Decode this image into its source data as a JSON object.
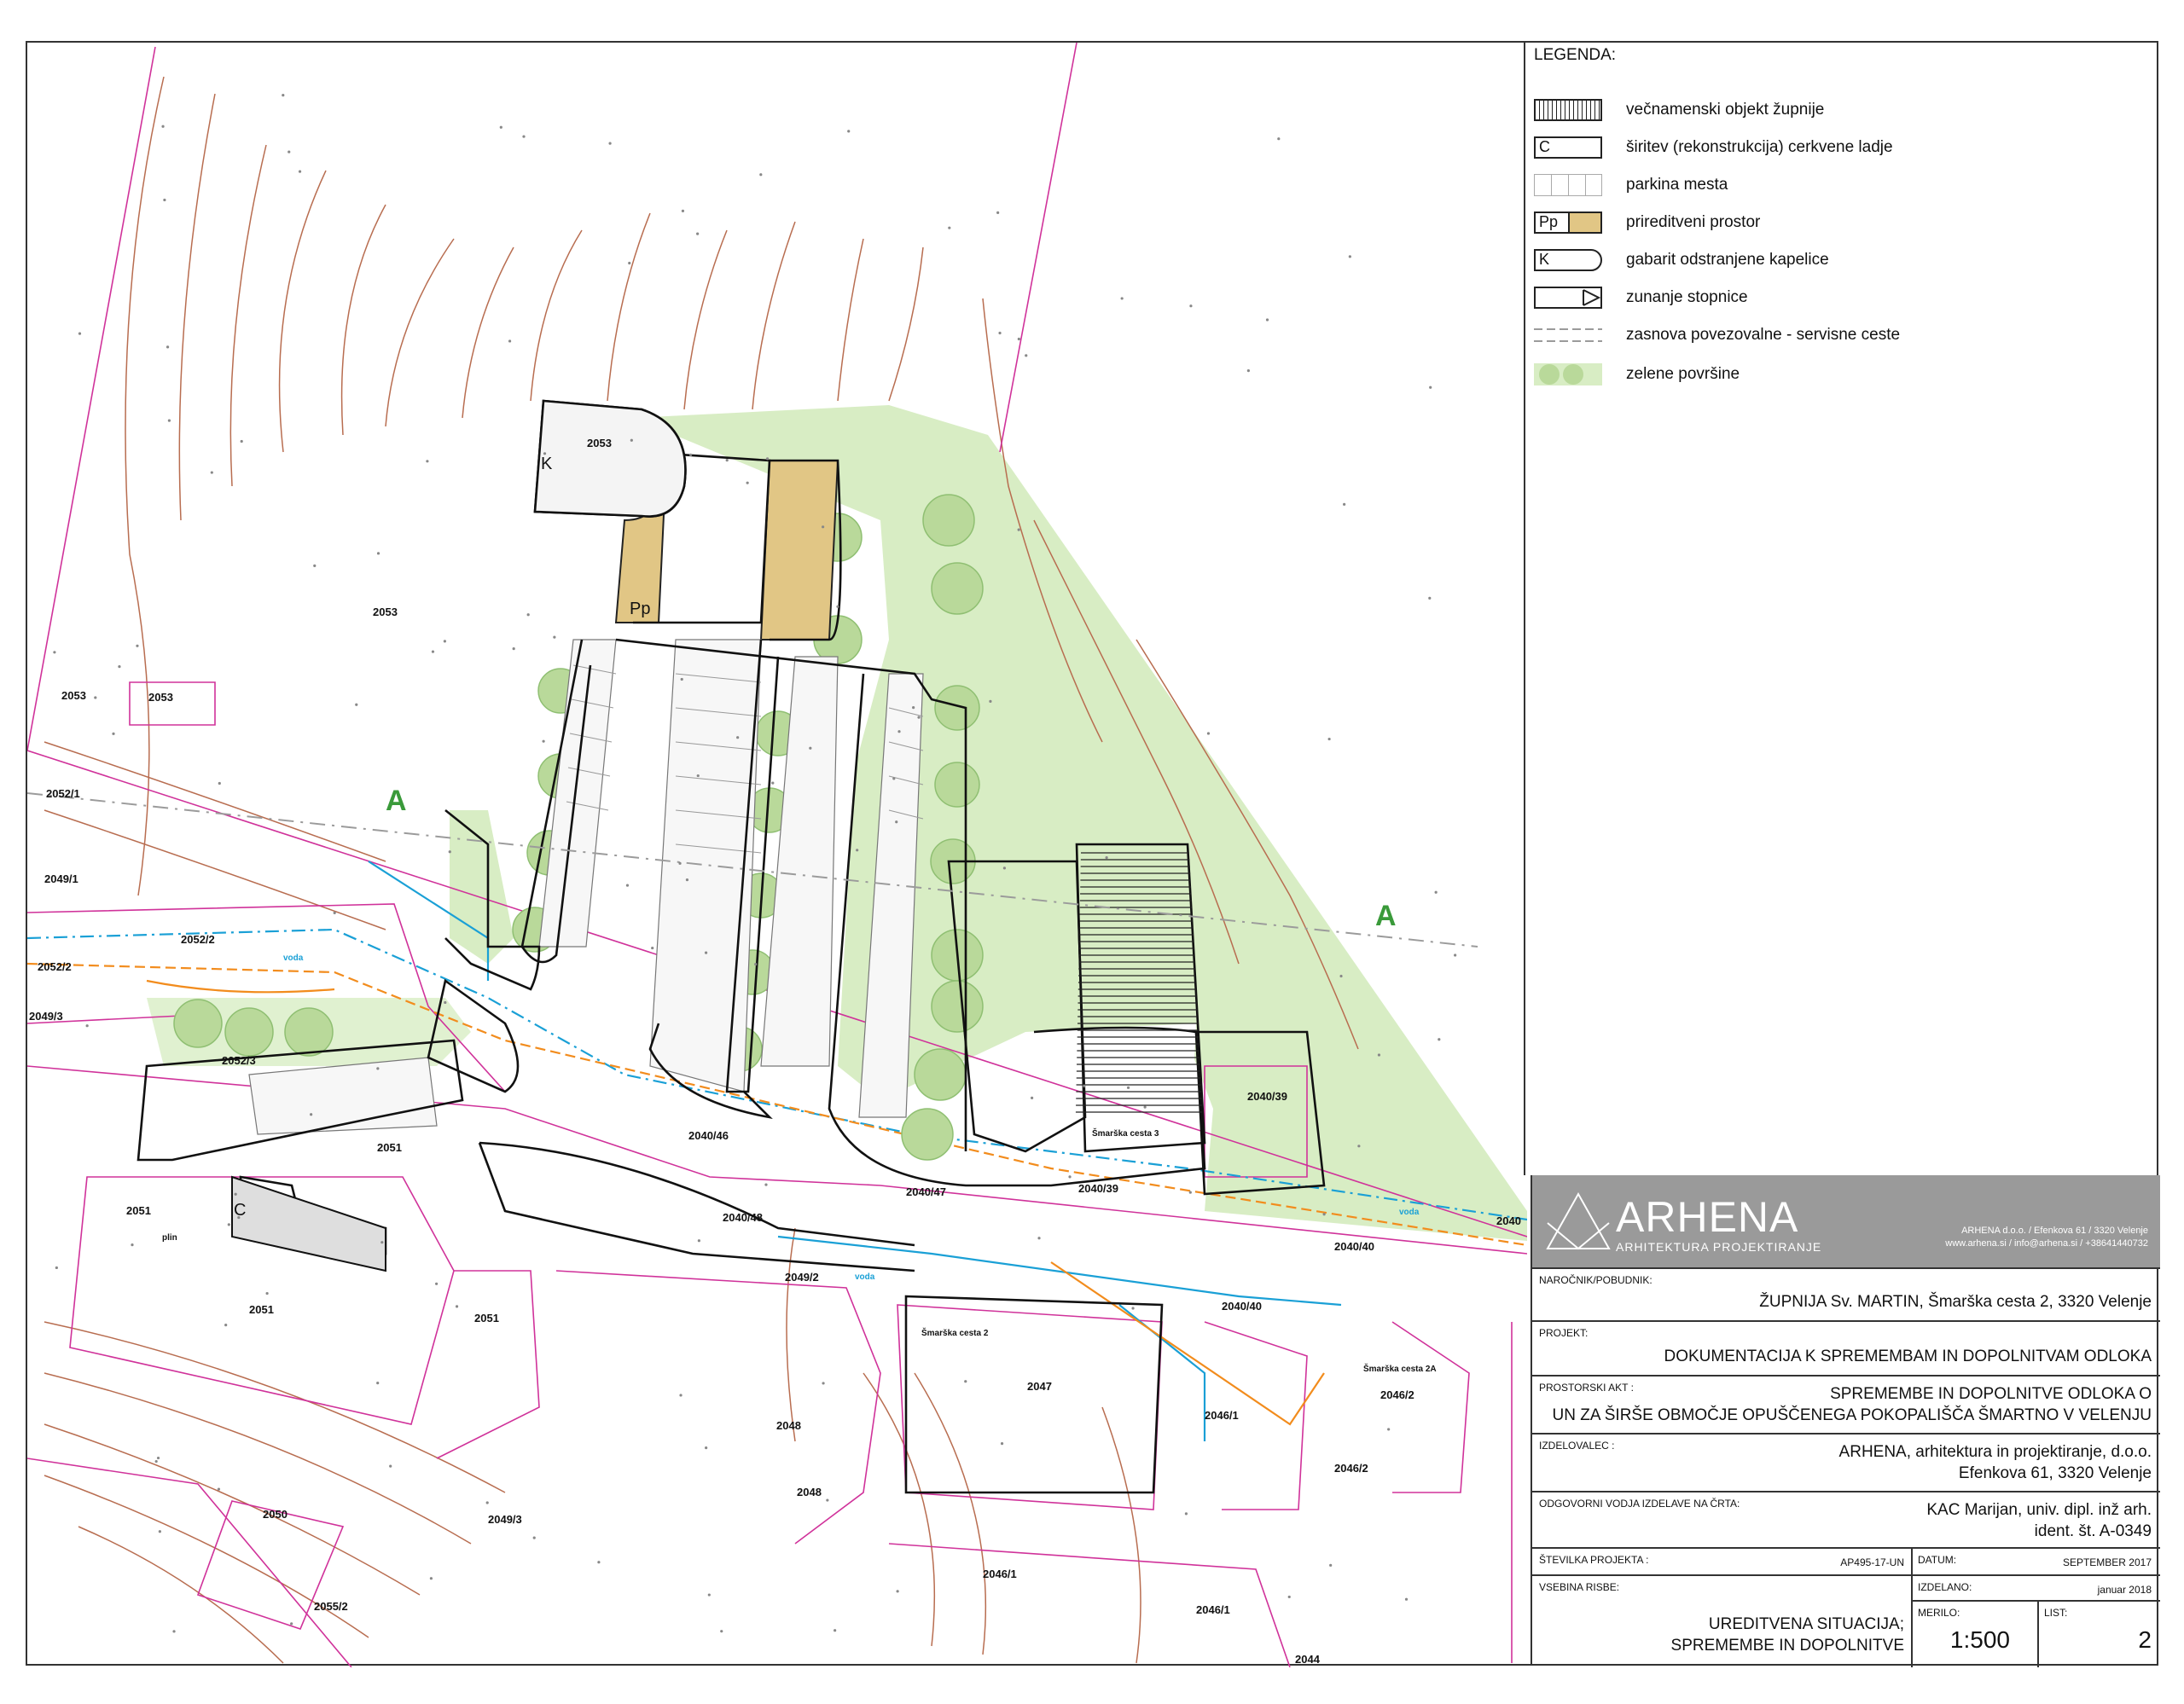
{
  "legend": {
    "title": "LEGENDA:",
    "items": [
      {
        "symbol_text": "",
        "label": "večnamenski objekt župnije"
      },
      {
        "symbol_text": "C",
        "label": "širitev (rekonstrukcija) cerkvene ladje"
      },
      {
        "symbol_text": "",
        "label": "parkina mesta"
      },
      {
        "symbol_text": "Pp",
        "label": "prireditveni prostor"
      },
      {
        "symbol_text": "K",
        "label": "gabarit odstranjene kapelice"
      },
      {
        "symbol_text": "",
        "label": "zunanje stopnice"
      },
      {
        "symbol_text": "",
        "label": "zasnova povezovalne - servisne ceste"
      },
      {
        "symbol_text": "",
        "label": "zelene površine"
      }
    ]
  },
  "colors": {
    "green_area": "#d8edc4",
    "tree_fill": "#b9d99a",
    "event_space": "#e1c685",
    "parcel_line": "#d0329a",
    "contour": "#b86d50",
    "water": "#1aa0d6",
    "gas": "#f28c1d"
  },
  "map": {
    "letters": [
      "A",
      "A",
      "K",
      "Pp",
      "C"
    ],
    "parcels": [
      "2053",
      "2053",
      "2053",
      "2053",
      "2052/1",
      "2049/1",
      "2052/2",
      "2052/2",
      "2049/3",
      "2052/3",
      "2051",
      "2051",
      "2051",
      "2051",
      "2050",
      "2055/2",
      "2049/3",
      "2040/46",
      "2040/48",
      "2040/47",
      "2040/39",
      "2040/39",
      "2040/40",
      "2040/40",
      "2049/2",
      "2047",
      "2048",
      "2048",
      "2046/1",
      "2046/1",
      "2046/1",
      "2046/2",
      "2046/2",
      "2044",
      "2040"
    ],
    "street_labels": [
      "Šmarška cesta 3",
      "Šmarška cesta 2",
      "Šmarška cesta 2A"
    ],
    "util_labels": [
      "voda",
      "voda",
      "voda",
      "plin"
    ]
  },
  "titleblock": {
    "brand": "ARHENA",
    "brand_sub": "ARHITEKTURA PROJEKTIRANJE",
    "brand_addr1": "ARHENA d.o.o. / Efenkova 61 / 3320 Velenje",
    "brand_addr2": "www.arhena.si / info@arhena.si / +38641440732",
    "narocnik_label": "NAROČNIK/POBUDNIK:",
    "narocnik": "ŽUPNIJA Sv. MARTIN, Šmarška cesta 2, 3320 Velenje",
    "projekt_label": "PROJEKT:",
    "projekt": "DOKUMENTACIJA K SPREMEMBAM IN DOPOLNITVAM ODLOKA",
    "akt_label": "PROSTORSKI AKT :",
    "akt_line1": "SPREMEMBE IN DOPOLNITVE ODLOKA O",
    "akt_line2": "UN ZA ŠIRŠE OBMOČJE OPUŠČENEGA POKOPALIŠČA ŠMARTNO V VELENJU",
    "izdelovalec_label": "IZDELOVALEC :",
    "izdelovalec_line1": "ARHENA, arhitektura in projektiranje, d.o.o.",
    "izdelovalec_line2": "Efenkova 61, 3320 Velenje",
    "vodja_label": "ODGOVORNI VODJA IZDELAVE NA ČRTA:",
    "vodja_line1": "KAC Marijan, univ. dipl. inž arh.",
    "vodja_line2": "ident. št. A-0349",
    "st_label": "ŠTEVILKA PROJEKTA :",
    "st": "AP495-17-UN",
    "datum_label": "DATUM:",
    "datum": "SEPTEMBER 2017",
    "izdelano_label": "IZDELANO:",
    "izdelano": "januar 2018",
    "vsebina_label": "VSEBINA RISBE:",
    "vsebina_line1": "UREDITVENA SITUACIJA;",
    "vsebina_line2": "SPREMEMBE IN DOPOLNITVE",
    "merilo_label": "MERILO:",
    "merilo": "1:500",
    "list_label": "LIST:",
    "list": "2"
  }
}
